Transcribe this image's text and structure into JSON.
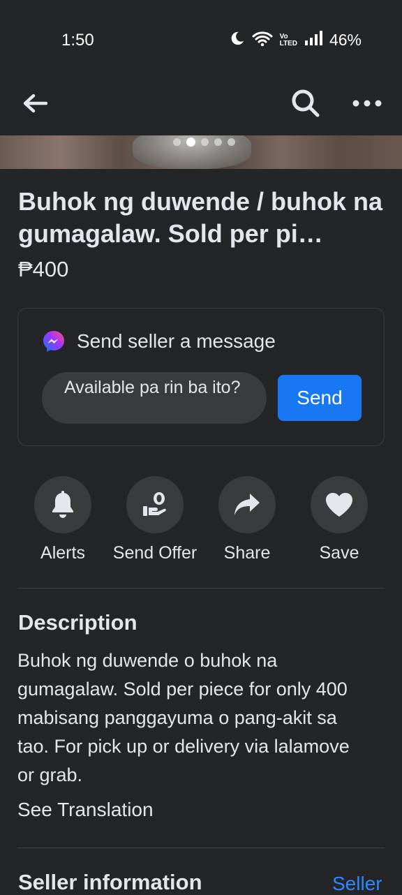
{
  "status_bar": {
    "time": "1:50",
    "volte_top": "Vo",
    "volte_bottom": "LTED",
    "battery": "46%"
  },
  "nav": {
    "back_icon": "arrow-left-icon",
    "search_icon": "search-icon",
    "more_icon": "more-horizontal-icon"
  },
  "photo": {
    "dot_count": 5,
    "active_dot": 2
  },
  "listing": {
    "title": "Buhok ng duwende / buhok na gumagalaw. Sold per pi…",
    "price": "₱400"
  },
  "message_card": {
    "heading": "Send seller a message",
    "input_value": "Available pa rin ba ito?",
    "send_label": "Send"
  },
  "actions": [
    {
      "label": "Alerts",
      "icon": "bell-icon"
    },
    {
      "label": "Send Offer",
      "icon": "offer-hand-icon"
    },
    {
      "label": "Share",
      "icon": "share-arrow-icon"
    },
    {
      "label": "Save",
      "icon": "heart-icon"
    }
  ],
  "description": {
    "heading": "Description",
    "body": "Buhok ng duwende o buhok na gumagalaw. Sold per piece for only 400 mabisang panggayuma o pang-akit sa tao. For pick up or delivery via lalamove or grab.",
    "see_translation": "See Translation"
  },
  "seller": {
    "heading": "Seller information",
    "link": "Seller"
  },
  "colors": {
    "background": "#242526",
    "accent": "#1877f2",
    "link": "#2d88ff",
    "surface": "#3a3b3c"
  }
}
